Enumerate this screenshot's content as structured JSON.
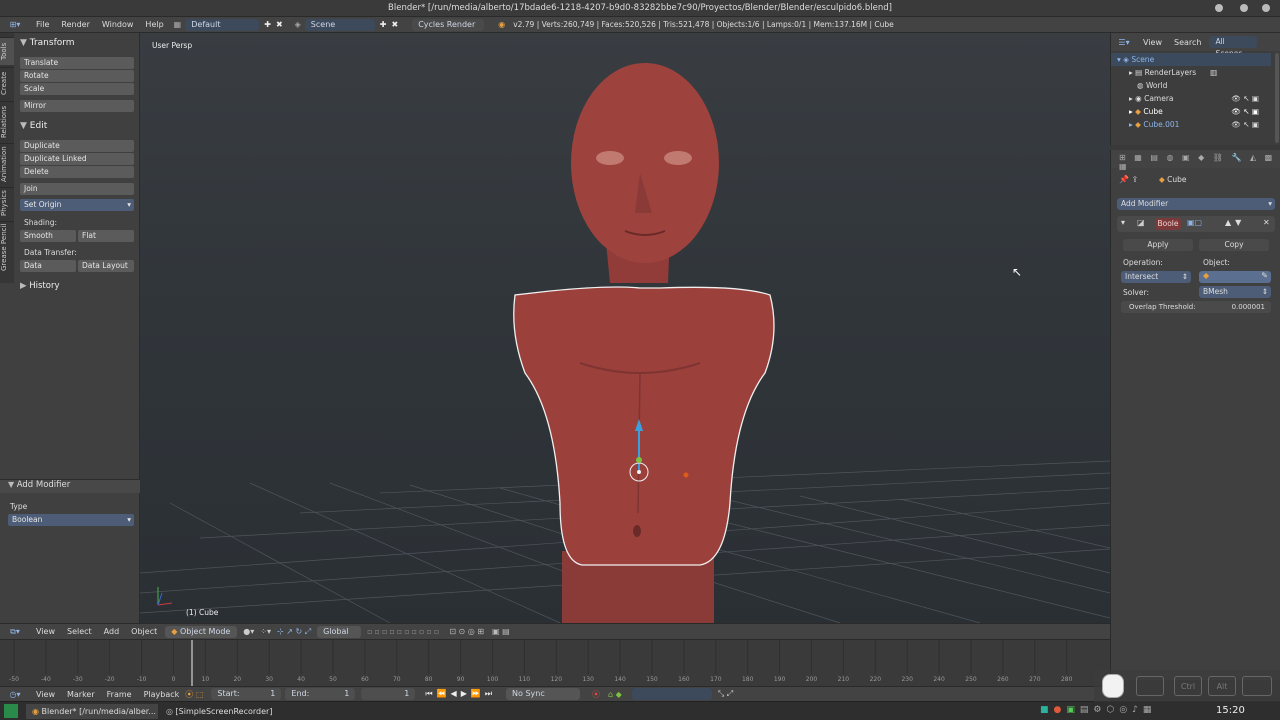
{
  "window": {
    "title": "Blender* [/run/media/alberto/17bdade6-1218-4207-b9d0-83282bbe7c90/Proyectos/Blender/Blender/esculpido6.blend]"
  },
  "info_bar": {
    "menus": [
      "File",
      "Render",
      "Window",
      "Help"
    ],
    "layout": "Default",
    "scene": "Scene",
    "engine": "Cycles Render",
    "stats": "v2.79 | Verts:260,749 | Faces:520,526 | Tris:521,478 | Objects:1/6 | Lamps:0/1 | Mem:137.16M | Cube"
  },
  "tool_shelf": {
    "tabs": [
      "Tools",
      "Create",
      "Relations",
      "Animation",
      "Physics",
      "Grease Pencil"
    ],
    "transform": {
      "title": "Transform",
      "buttons": [
        "Translate",
        "Rotate",
        "Scale",
        "Mirror"
      ]
    },
    "edit": {
      "title": "Edit",
      "buttons": [
        "Duplicate",
        "Duplicate Linked",
        "Delete",
        "Join"
      ],
      "set_origin": "Set Origin",
      "shading_label": "Shading:",
      "smooth": "Smooth",
      "flat": "Flat",
      "data_transfer_label": "Data Transfer:",
      "data": "Data",
      "data_layout": "Data Layout"
    },
    "history": "History",
    "operator": {
      "title": "Add Modifier",
      "type_label": "Type",
      "type_value": "Boolean"
    }
  },
  "viewport": {
    "view_name": "User Persp",
    "object_label": "(1) Cube"
  },
  "viewport_header": {
    "menus": [
      "View",
      "Select",
      "Add",
      "Object"
    ],
    "mode": "Object Mode",
    "orientation": "Global"
  },
  "timeline": {
    "ticks": [
      "-50",
      "-40",
      "-30",
      "-20",
      "-10",
      "0",
      "10",
      "20",
      "30",
      "40",
      "50",
      "60",
      "70",
      "80",
      "90",
      "100",
      "110",
      "120",
      "130",
      "140",
      "150",
      "160",
      "170",
      "180",
      "190",
      "200",
      "210",
      "220",
      "230",
      "240",
      "250",
      "260",
      "270",
      "280"
    ],
    "menus": [
      "View",
      "Marker",
      "Frame",
      "Playback"
    ],
    "start_label": "Start:",
    "start": "1",
    "end_label": "End:",
    "end": "1",
    "current": "1",
    "sync": "No Sync"
  },
  "outliner": {
    "menus": [
      "View",
      "Search"
    ],
    "filter": "All Scenes",
    "rows": [
      "Scene",
      "RenderLayers",
      "World",
      "Camera",
      "Cube",
      "Cube.001"
    ]
  },
  "properties": {
    "object_name": "Cube",
    "add_modifier": "Add Modifier",
    "modifier_name": "Boole",
    "apply": "Apply",
    "copy": "Copy",
    "operation_label": "Operation:",
    "operation": "Intersect",
    "object_label": "Object:",
    "solver_label": "Solver:",
    "solver": "BMesh",
    "overlap_label": "Overlap Threshold:",
    "overlap_value": "0.000001"
  },
  "taskbar": {
    "items": [
      "Blender* [/run/media/alber...",
      "[SimpleScreenRecorder]"
    ],
    "keys": [
      "Ctrl",
      "Alt"
    ],
    "clock": "15:20"
  }
}
